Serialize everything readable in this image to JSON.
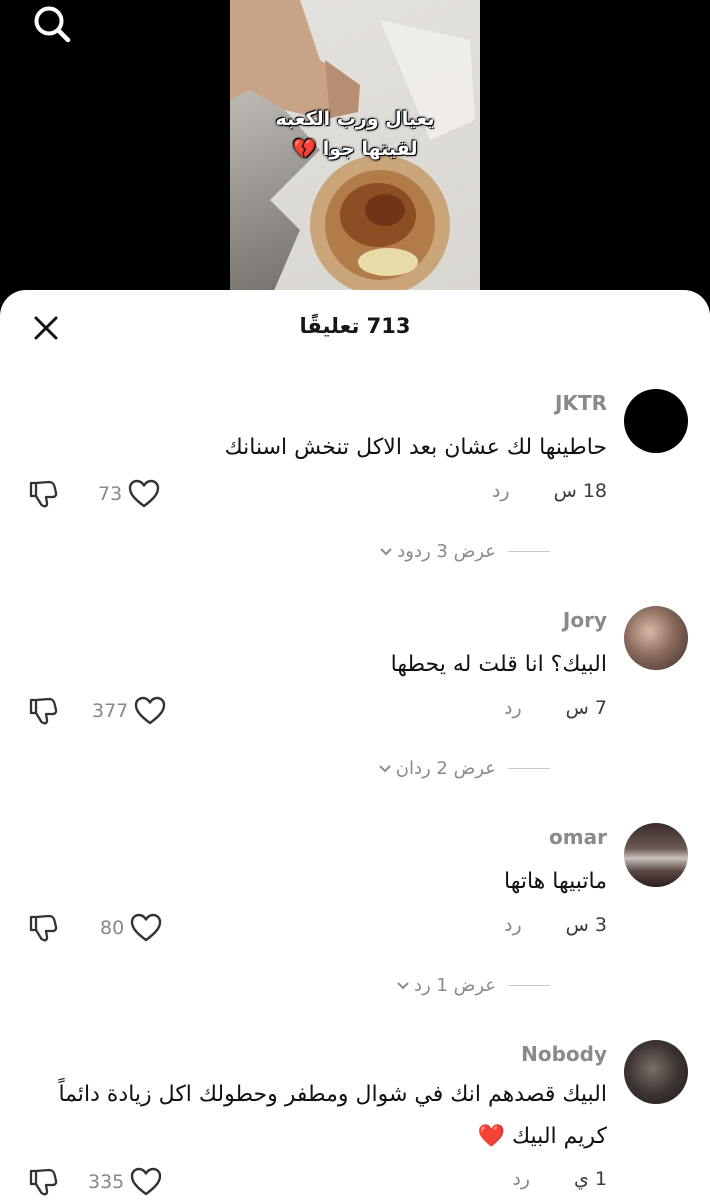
{
  "video": {
    "overlay_line1": "يعيال ورب الكعبه",
    "overlay_line2": "لقيتها جوا 💔",
    "search_icon": "search-icon"
  },
  "sheet": {
    "title": "713 تعليقًا",
    "close_icon": "close-icon"
  },
  "comments": [
    {
      "username": "JKTR",
      "text": "حاطينها لك عشان بعد الاكل تنخش اسنانك",
      "time": "18 س",
      "reply": "رد",
      "likes": "73",
      "view_replies": "عرض 3 ردود"
    },
    {
      "username": "Jory",
      "text": "البيك؟ انا قلت له يحطها",
      "time": "7 س",
      "reply": "رد",
      "likes": "377",
      "view_replies": "عرض 2 ردان"
    },
    {
      "username": "omar",
      "text": "ماتبيها هاتها",
      "time": "3 س",
      "reply": "رد",
      "likes": "80",
      "view_replies": "عرض 1 رد"
    },
    {
      "username": "Nobody",
      "text_line1": "البيك قصدهم انك في شوال ومطفر وحطولك اكل زيادة دائماً",
      "text_line2": "كريم البيك ❤️",
      "time": "1 ي",
      "reply": "رد",
      "likes": "335"
    }
  ]
}
